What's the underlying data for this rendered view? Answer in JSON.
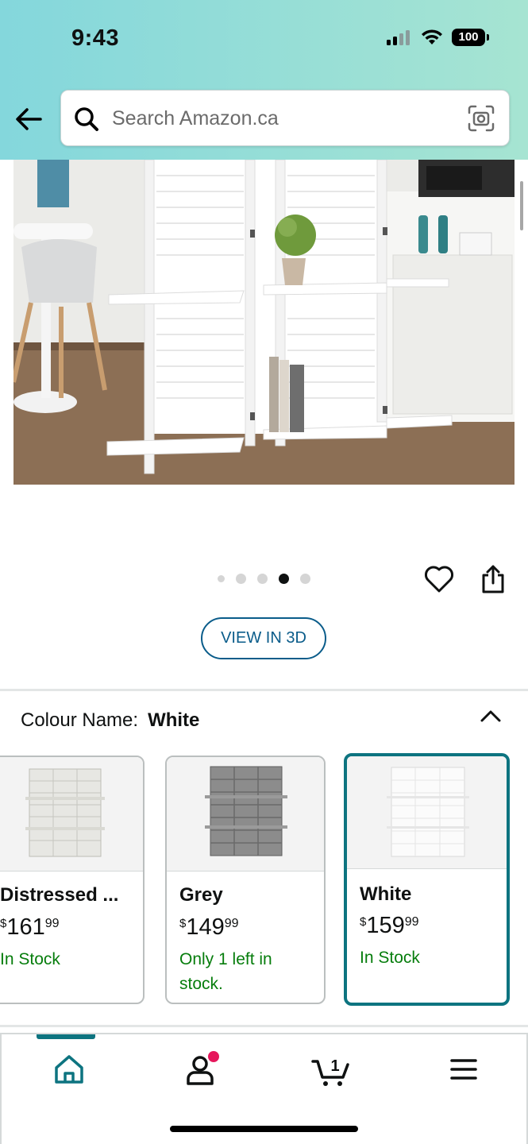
{
  "status_bar": {
    "time": "9:43",
    "battery": "100"
  },
  "search": {
    "placeholder": "Search Amazon.ca"
  },
  "gallery": {
    "dot_count": 5,
    "active_index": 3
  },
  "view_3d_label": "VIEW IN 3D",
  "colour": {
    "label": "Colour Name:",
    "selected": "White"
  },
  "variants": [
    {
      "name": "Distressed ...",
      "currency": "$",
      "price_whole": "161",
      "price_cents": "99",
      "stock": "In Stock"
    },
    {
      "name": "Grey",
      "currency": "$",
      "price_whole": "149",
      "price_cents": "99",
      "stock": "Only 1 left in stock."
    },
    {
      "name": "White",
      "currency": "$",
      "price_whole": "159",
      "price_cents": "99",
      "stock": "In Stock"
    }
  ],
  "bottom_nav": {
    "items": [
      "home-icon",
      "account-icon",
      "cart-icon",
      "menu-icon"
    ],
    "cart_count": "1",
    "accent": "#0d7480",
    "notification_dot": "#e6175c"
  }
}
